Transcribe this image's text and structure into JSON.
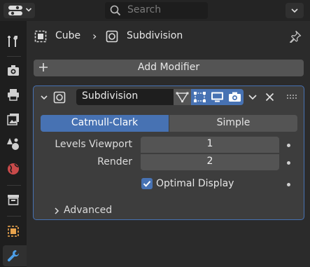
{
  "header": {
    "search_placeholder": "Search",
    "editor_type_icon": "properties-editor-icon",
    "menu_icon": "chevron-down-icon"
  },
  "tabs": [
    {
      "name": "tool",
      "icon": "tool-icon"
    },
    {
      "name": "render",
      "icon": "render-icon"
    },
    {
      "name": "output",
      "icon": "output-icon"
    },
    {
      "name": "view-layer",
      "icon": "view-layer-icon"
    },
    {
      "name": "scene",
      "icon": "scene-icon"
    },
    {
      "name": "world",
      "icon": "world-icon"
    },
    {
      "name": "collection",
      "icon": "collection-icon"
    },
    {
      "name": "object",
      "icon": "object-icon"
    },
    {
      "name": "modifiers",
      "icon": "wrench-icon",
      "active": true
    }
  ],
  "breadcrumb": {
    "object": "Cube",
    "separator": "›",
    "modifier": "Subdivision"
  },
  "add_modifier": {
    "label": "Add Modifier"
  },
  "modifier": {
    "name": "Subdivision",
    "toggles": {
      "edit_cage": false,
      "edit_mode": true,
      "viewport": true,
      "render": true
    },
    "modes": {
      "selected": "Catmull-Clark",
      "other": "Simple"
    },
    "levels_viewport_label": "Levels Viewport",
    "levels_viewport": "1",
    "render_label": "Render",
    "render_levels": "2",
    "optimal_display_label": "Optimal Display",
    "optimal_display_checked": true,
    "advanced_label": "Advanced"
  },
  "colors": {
    "accent": "#4772b3",
    "panel_bg": "#3d3d3d",
    "bg": "#2b2b2b",
    "field": "#545454"
  }
}
